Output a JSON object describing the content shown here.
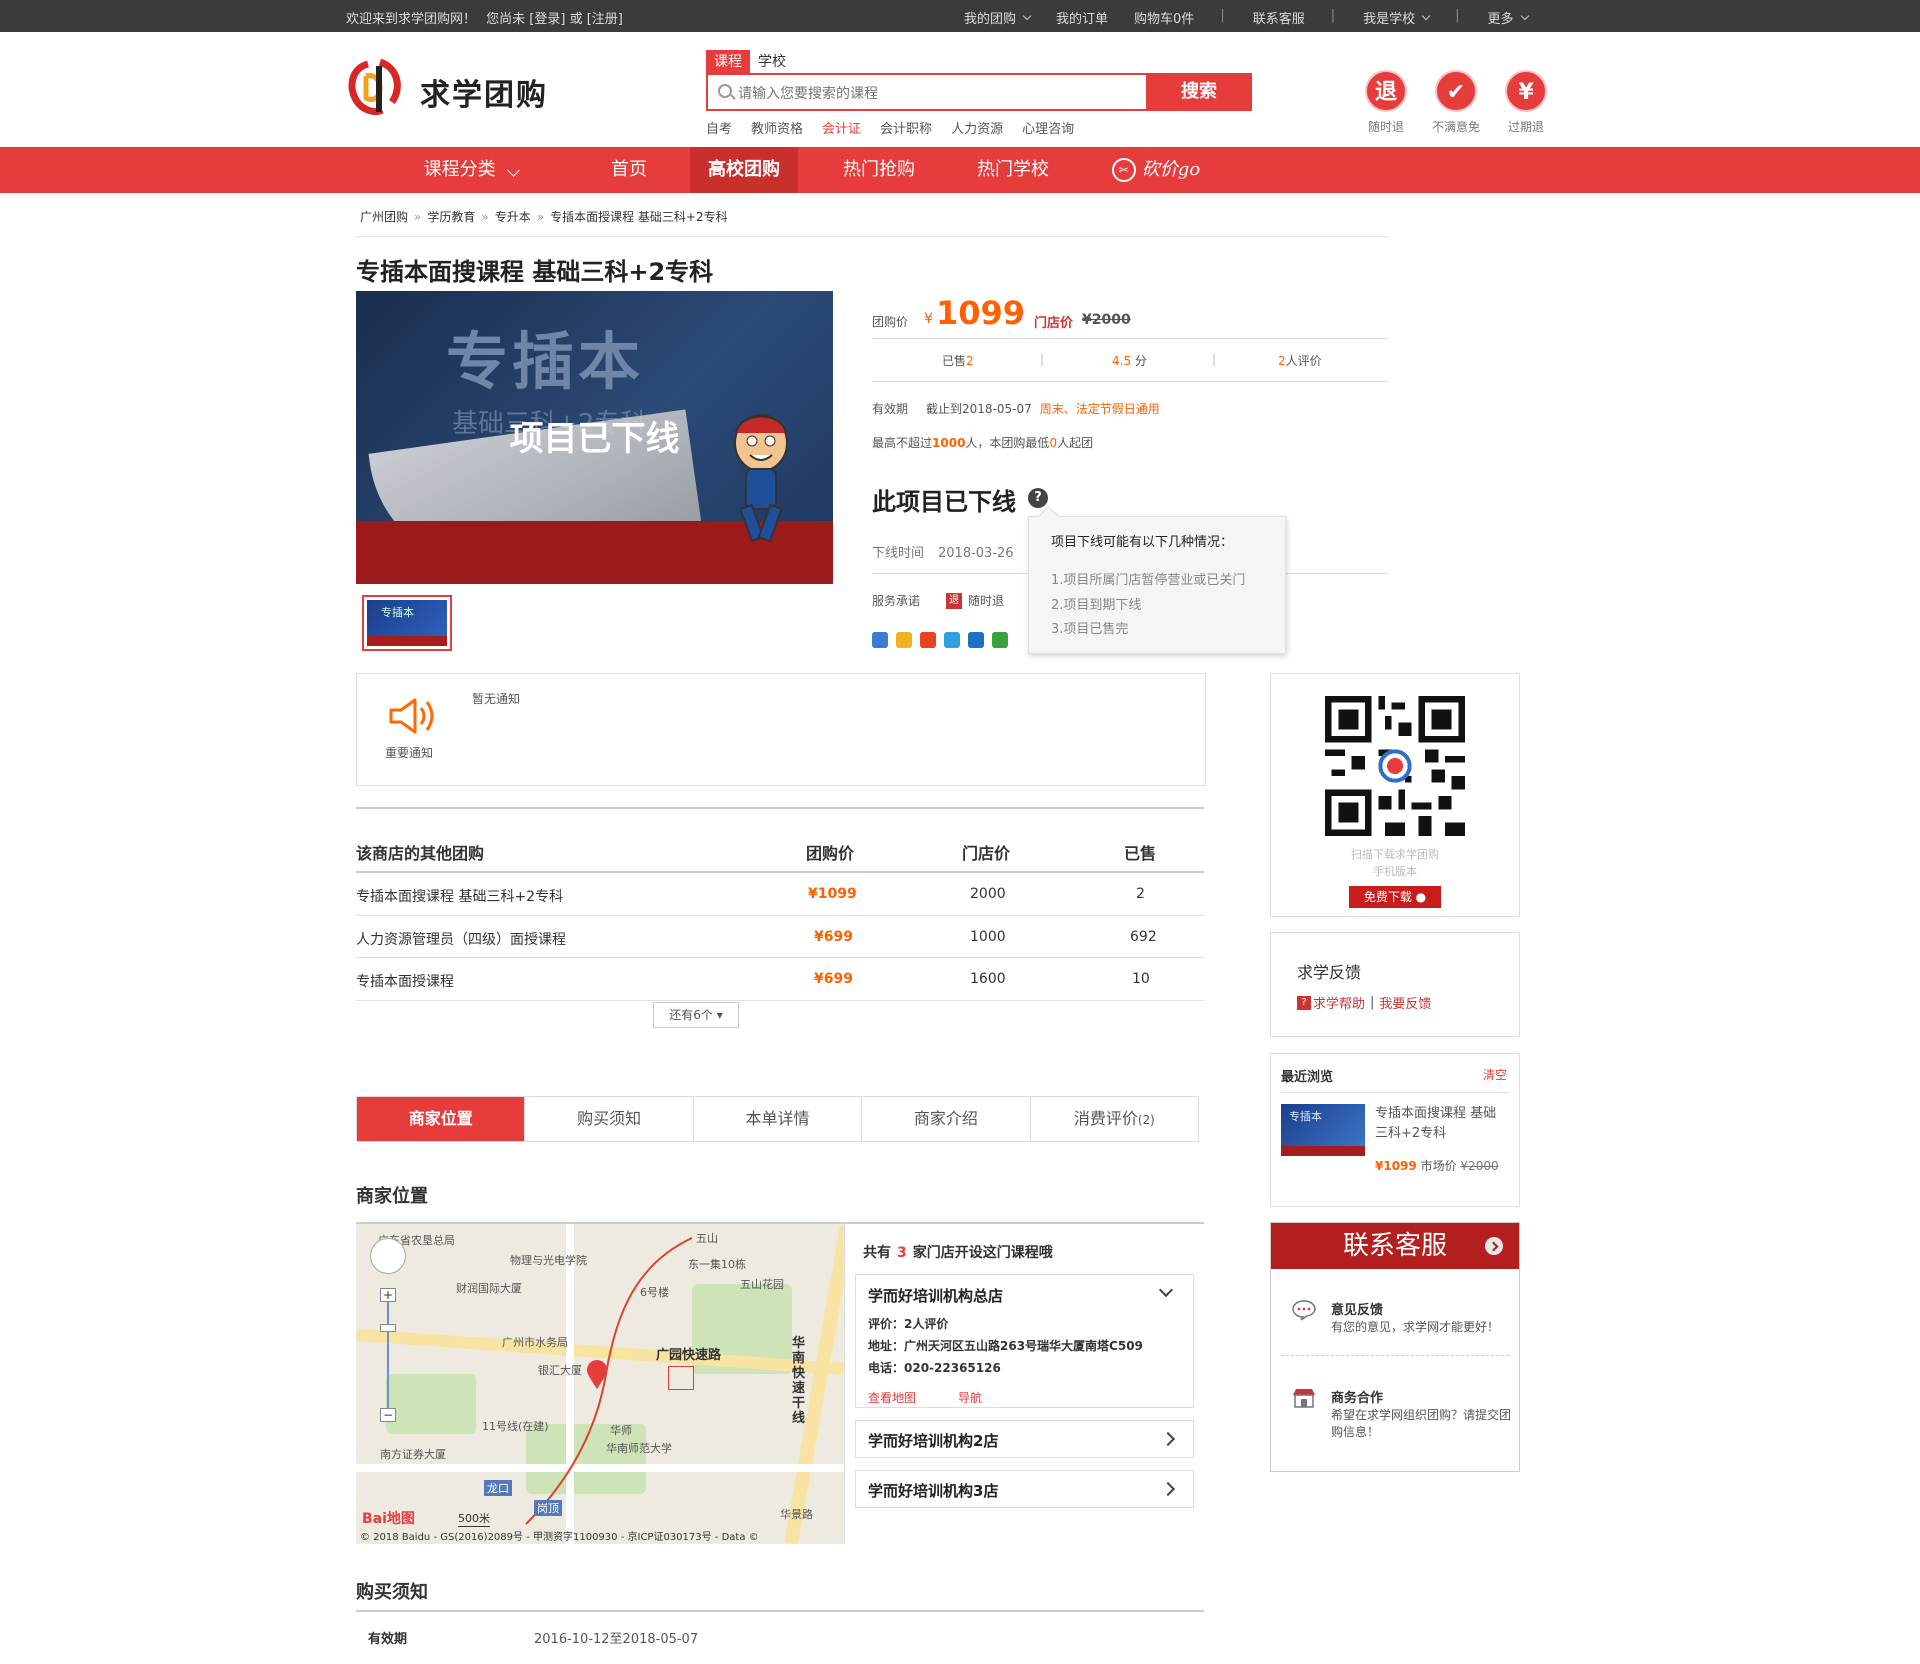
{
  "topbar": {
    "welcome": "欢迎来到求学团购网！",
    "login_prompt": "您尚未 [登录] 或 [注册]",
    "my_groupbuy": "我的团购",
    "my_orders": "我的订单",
    "cart": "购物车0件",
    "customer_service": "联系客服",
    "school": "我是学校",
    "more": "更多"
  },
  "header": {
    "logo_text": "求学团购",
    "search_tabs": [
      "课程",
      "学校"
    ],
    "search_placeholder": "请输入您要搜索的课程",
    "search_button": "搜索",
    "hot_words": [
      "自考",
      "教师资格",
      "会计证",
      "会计职称",
      "人力资源",
      "心理咨询"
    ],
    "hot_words_highlight_index": 2,
    "promises": [
      {
        "glyph": "退",
        "label": "随时退"
      },
      {
        "glyph": "✔",
        "label": "不满意免"
      },
      {
        "glyph": "¥",
        "label": "过期退"
      }
    ]
  },
  "nav": {
    "category": "课程分类",
    "items": [
      "首页",
      "高校团购",
      "热门抢购",
      "热门学校",
      "砍价go"
    ],
    "active_index": 1
  },
  "breadcrumb": [
    "广州团购",
    "学历教育",
    "专升本",
    "专插本面授课程 基础三科+2专科"
  ],
  "product": {
    "title": "专插本面搜课程 基础三科+2专科",
    "image_text_main": "专插本",
    "image_text_sub": "基础三科+2专科",
    "overlay": "项目已下线",
    "thumb_text": "专插本",
    "group_price_label": "团购价",
    "currency": "¥",
    "group_price": "1099",
    "store_price_label": "门店价",
    "store_price": "¥2000",
    "sold_label": "已售",
    "sold": "2",
    "rating": "4.5",
    "rating_unit": "分",
    "reviews": "2",
    "reviews_suffix": "人评价",
    "validity_label": "有效期",
    "validity": "截止到2018-05-07",
    "validity_note": "周末、法定节假日通用",
    "limit_prefix": "最高不超过",
    "limit_max": "1000",
    "limit_mid": "人，本团购最低",
    "limit_min": "0",
    "limit_suffix": "人起团",
    "offline_title": "此项目已下线",
    "offline_time_label": "下线时间",
    "offline_time": "2018-03-26",
    "service_label": "服务承诺",
    "service_icon_text": "退",
    "service": "随时退",
    "share_icon_colors": [
      "#3a7bd5",
      "#f0b323",
      "#e8421f",
      "#2fa0df",
      "#1f6fc5",
      "#37a53b"
    ]
  },
  "tooltip": {
    "heading": "项目下线可能有以下几种情况：",
    "reasons": [
      "1.项目所属门店暂停营业或已关门",
      "2.项目到期下线",
      "3.项目已售完"
    ]
  },
  "notice": {
    "label": "重要通知",
    "text": "暂无通知"
  },
  "other_deals": {
    "headers": [
      "该商店的其他团购",
      "团购价",
      "门店价",
      "已售"
    ],
    "rows": [
      {
        "name": "专插本面搜课程 基础三科+2专科",
        "price": "¥1099",
        "store": "2000",
        "sold": "2"
      },
      {
        "name": "人力资源管理员（四级）面授课程",
        "price": "¥699",
        "store": "1000",
        "sold": "692"
      },
      {
        "name": "专插本面授课程",
        "price": "¥699",
        "store": "1600",
        "sold": "10"
      }
    ],
    "more": "还有6个"
  },
  "tabs": {
    "items": [
      "商家位置",
      "购买须知",
      "本单详情",
      "商家介绍",
      "消费评价"
    ],
    "review_count": "(2)",
    "active_index": 0
  },
  "location": {
    "title": "商家位置",
    "map_labels": [
      "广东省农垦总局",
      "物理与光电学院",
      "五山",
      "东一集10栋",
      "6号楼",
      "五山花园",
      "财润国际大厦",
      "广州市水务局",
      "银汇大厦",
      "广园快速路",
      "华南快速干线",
      "11号线(在建)",
      "华师",
      "华南师范大学",
      "南方证券大厦",
      "龙口",
      "岗顶",
      "华景路",
      "500米"
    ],
    "map_copyright": "© 2018 Baidu - GS(2016)2089号 - 甲测资字1100930 - 京ICP证030173号 - Data ©",
    "baidu_logo": "Bai地图",
    "shops_prefix": "共有",
    "shops_count": "3",
    "shops_suffix": "家门店开设这门课程哦",
    "shop_main": {
      "name": "学而好培训机构总店",
      "rating": "评价：2人评价",
      "address": "地址：广州天河区五山路263号瑞华大厦南塔C509",
      "phone": "电话：020-22365126",
      "view_map": "查看地图",
      "navigate": "导航"
    },
    "other_shops": [
      "学而好培训机构2店",
      "学而好培训机构3店"
    ]
  },
  "purchase_notes": {
    "title": "购买须知",
    "validity_label": "有效期",
    "validity": "2016-10-12至2018-05-07"
  },
  "sidebar": {
    "qr_text1": "扫描下载求学团购",
    "qr_text2": "手机版本",
    "download": "免费下载",
    "feedback_title": "求学反馈",
    "help": "求学帮助",
    "sep": "|",
    "feedback": "我要反馈",
    "recent_title": "最近浏览",
    "clear": "清空",
    "recent_thumb_text": "专插本",
    "recent_name": "专插本面搜课程 基础三科+2专科",
    "recent_price": "¥1099",
    "recent_market_label": "市场价",
    "recent_market": "¥2000",
    "cs_title": "联系客服",
    "cs_items": [
      {
        "title": "意见反馈",
        "desc": "有您的意见，求学网才能更好！"
      },
      {
        "title": "商务合作",
        "desc": "希望在求学网组织团购？请提交团购信息！"
      }
    ]
  },
  "colors": {
    "brand_red": "#e63c3c",
    "price_orange": "#ff6000",
    "topbar": "#3b3b3b"
  }
}
